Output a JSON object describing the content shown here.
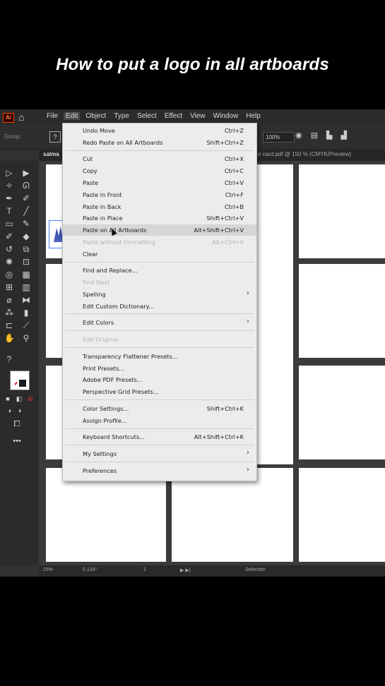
{
  "caption": "How to put a logo in all artboards",
  "menubar": {
    "logo": "Ai",
    "items": [
      "File",
      "Edit",
      "Object",
      "Type",
      "Select",
      "Effect",
      "View",
      "Window",
      "Help"
    ]
  },
  "control_bar": {
    "group_label": "Group",
    "zoom_field": "100%"
  },
  "tabs": {
    "left": "salma",
    "right": "e card.pdf @ 150 % (CMYK/Preview)"
  },
  "statusbar": {
    "zoom": "25%",
    "angle": "0.124°",
    "page": "1",
    "tool": "Selection"
  },
  "edit_menu": {
    "items": [
      {
        "label": "Undo Move",
        "shortcut": "Ctrl+Z"
      },
      {
        "label": "Redo Paste on All Artboards",
        "shortcut": "Shift+Ctrl+Z"
      },
      {
        "label": "Cut",
        "shortcut": "Ctrl+X"
      },
      {
        "label": "Copy",
        "shortcut": "Ctrl+C"
      },
      {
        "label": "Paste",
        "shortcut": "Ctrl+V"
      },
      {
        "label": "Paste in Front",
        "shortcut": "Ctrl+F"
      },
      {
        "label": "Paste in Back",
        "shortcut": "Ctrl+B"
      },
      {
        "label": "Paste in Place",
        "shortcut": "Shift+Ctrl+V"
      },
      {
        "label": "Paste on All Artboards",
        "shortcut": "Alt+Shift+Ctrl+V"
      },
      {
        "label": "Paste without Formatting",
        "shortcut": "Alt+Ctrl+V"
      },
      {
        "label": "Clear",
        "shortcut": ""
      },
      {
        "label": "Find and Replace...",
        "shortcut": ""
      },
      {
        "label": "Find Next",
        "shortcut": ""
      },
      {
        "label": "Spelling",
        "shortcut": ""
      },
      {
        "label": "Edit Custom Dictionary...",
        "shortcut": ""
      },
      {
        "label": "Edit Colors",
        "shortcut": ""
      },
      {
        "label": "Edit Original",
        "shortcut": ""
      },
      {
        "label": "Transparency Flattener Presets...",
        "shortcut": ""
      },
      {
        "label": "Print Presets...",
        "shortcut": ""
      },
      {
        "label": "Adobe PDF Presets...",
        "shortcut": ""
      },
      {
        "label": "Perspective Grid Presets...",
        "shortcut": ""
      },
      {
        "label": "Color Settings...",
        "shortcut": "Shift+Ctrl+K"
      },
      {
        "label": "Assign Profile...",
        "shortcut": ""
      },
      {
        "label": "Keyboard Shortcuts...",
        "shortcut": "Alt+Shift+Ctrl+K"
      },
      {
        "label": "My Settings",
        "shortcut": ""
      },
      {
        "label": "Preferences",
        "shortcut": ""
      }
    ]
  },
  "colors": {
    "accent_hover": "#d6d6d6",
    "fill_none_slash": "#e00000",
    "app_bg": "#323232"
  }
}
